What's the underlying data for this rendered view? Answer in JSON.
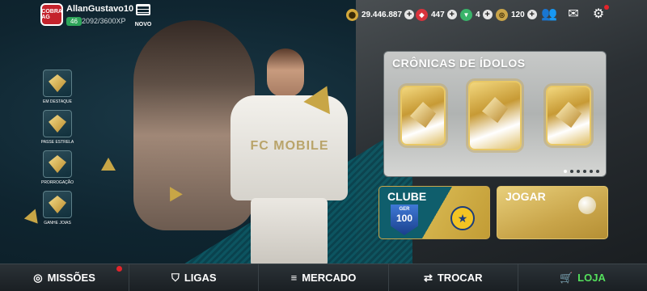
{
  "profile": {
    "username": "AllanGustavo10",
    "level": "46",
    "xp": "2092/3600XP",
    "avatar_text": "COBRA AG"
  },
  "news": {
    "label": "NOVO"
  },
  "currencies": [
    {
      "icon": "coins-icon",
      "value": "29.446.887",
      "color": "#d4a93c"
    },
    {
      "icon": "gems-icon",
      "value": "447",
      "color": "#d8333c"
    },
    {
      "icon": "token-icon",
      "value": "4",
      "color": "#39b46a"
    },
    {
      "icon": "points-icon",
      "value": "120",
      "color": "#c9a449"
    }
  ],
  "side_menu": [
    {
      "label": "EM DESTAQUE"
    },
    {
      "label": "PASSE ESTRELA"
    },
    {
      "label": "PRORROGAÇÃO"
    },
    {
      "label": "GANHE JOIAS"
    }
  ],
  "cronicas": {
    "title": "CRÔNICAS DE ÍDOLOS",
    "pages": 6,
    "active_page": 1
  },
  "clube": {
    "title": "CLUBE",
    "ger_label": "GER",
    "rating": "100"
  },
  "jogar": {
    "title": "JOGAR"
  },
  "player_art": {
    "brand": "FC MOBILE"
  },
  "bottom_nav": [
    {
      "label": "MISSÕES",
      "icon": "target-icon"
    },
    {
      "label": "LIGAS",
      "icon": "shield-icon"
    },
    {
      "label": "MERCADO",
      "icon": "coins-stack-icon"
    },
    {
      "label": "TROCAR",
      "icon": "swap-icon"
    },
    {
      "label": "LOJA",
      "icon": "cart-icon"
    }
  ],
  "colors": {
    "active_nav": "#54e05c",
    "notification": "#e3242b",
    "accent_gold": "#c9a449"
  }
}
